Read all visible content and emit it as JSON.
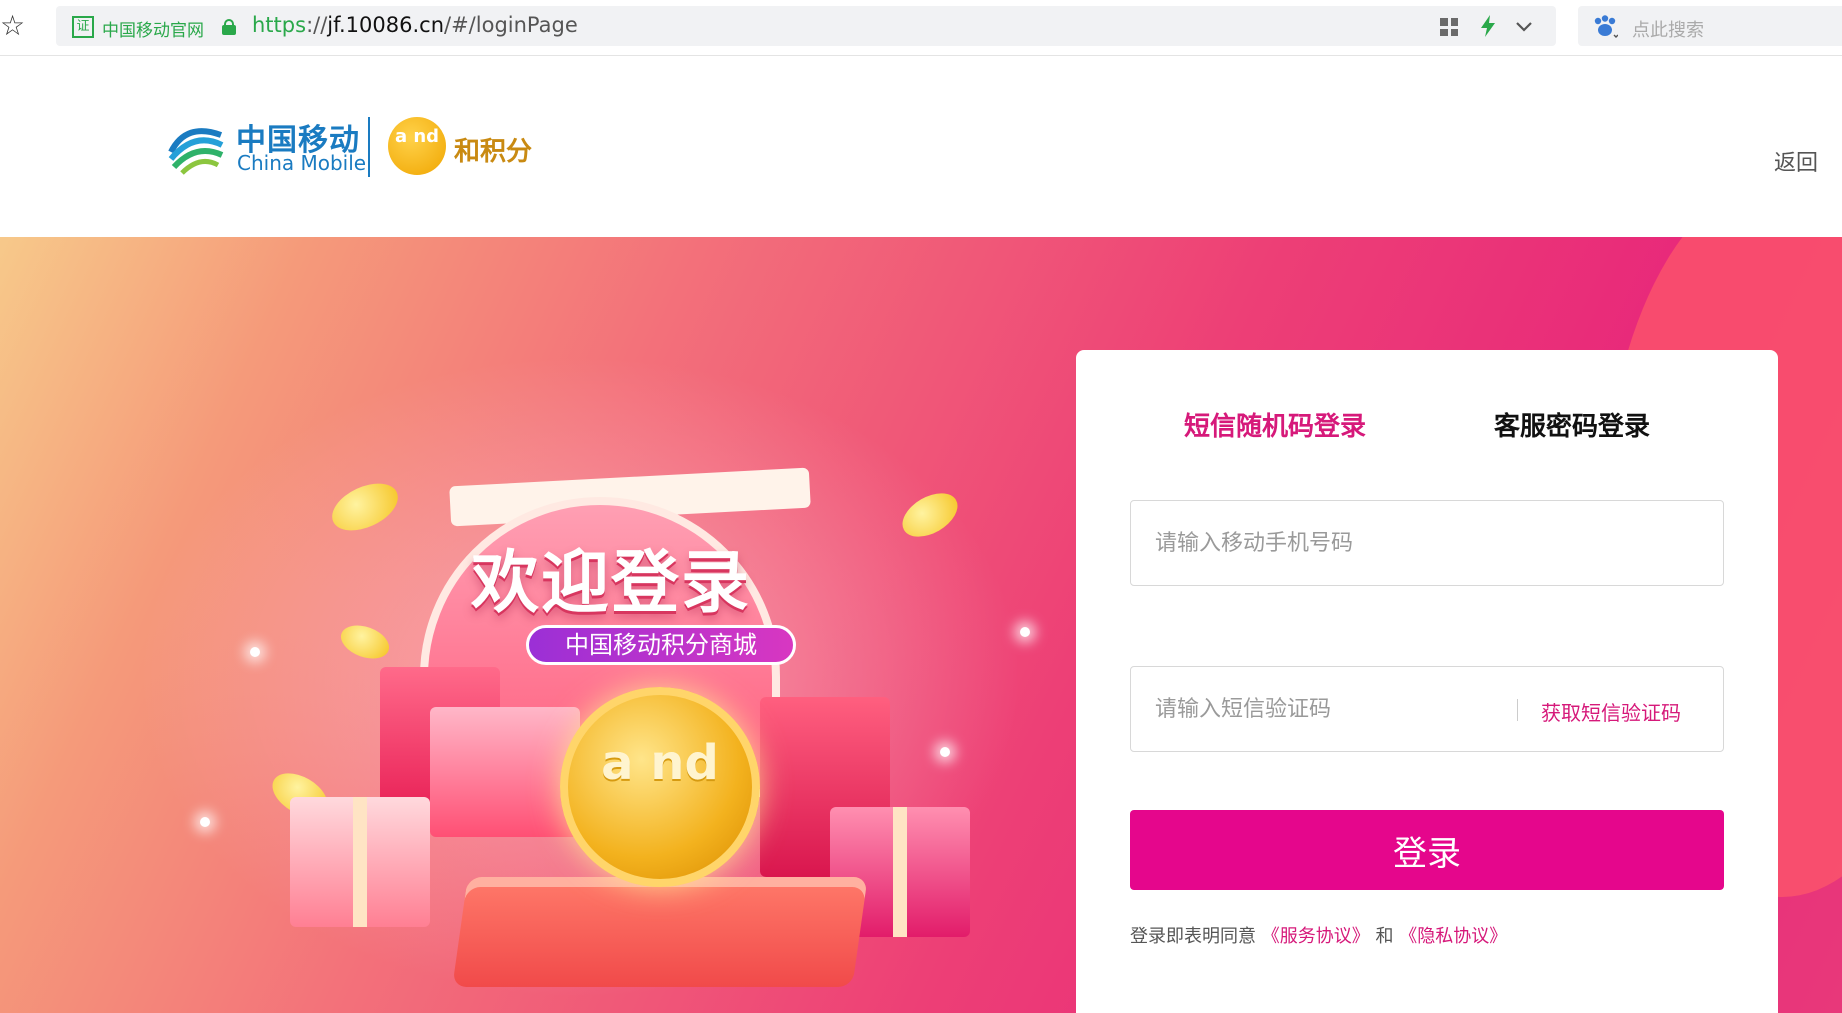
{
  "browser": {
    "site_name": "中国移动官网",
    "url_proto": "https",
    "url_sep": "://",
    "url_host": "jf.10086.cn",
    "url_path": "/#/loginPage",
    "search_placeholder": "点此搜索",
    "cert_icon_label": "证",
    "icons": [
      "star-icon",
      "cert-icon",
      "lock-icon",
      "qr-icon",
      "bolt-icon",
      "chevron-down-icon",
      "paw-icon"
    ]
  },
  "header": {
    "brand_cn": "中国移动",
    "brand_en": "China Mobile",
    "and_logo_text": "a nd",
    "points_brand": "和积分",
    "back_label": "返回"
  },
  "hero": {
    "welcome_title": "欢迎登录",
    "welcome_subtitle": "中国移动积分商城",
    "coin_text": "a nd"
  },
  "login": {
    "tab_sms": "短信随机码登录",
    "tab_password": "客服密码登录",
    "phone_placeholder": "请输入移动手机号码",
    "code_placeholder": "请输入短信验证码",
    "get_code_label": "获取短信验证码",
    "login_label": "登录",
    "agreement_prefix": "登录即表明同意",
    "service_agreement": "《服务协议》",
    "and_word": "和",
    "privacy_agreement": "《隐私协议》"
  },
  "colors": {
    "brand_pink": "#e5068c",
    "tab_active": "#d6197a",
    "secure_green": "#2aa84a",
    "china_mobile_blue": "#1a7bc1"
  }
}
